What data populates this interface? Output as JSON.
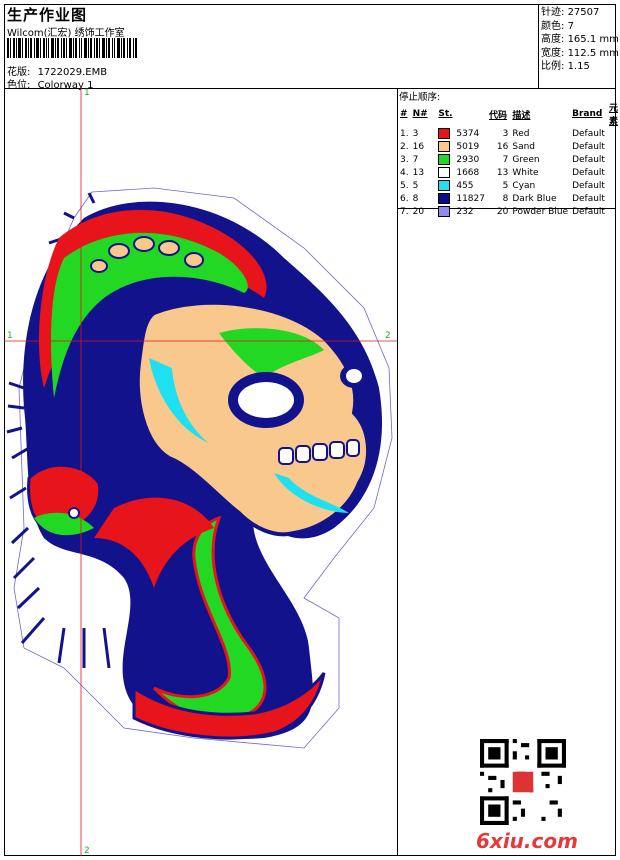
{
  "header": {
    "title": "生产作业图",
    "subtitle": "Wilcom(汇宏) 绣饰工作室",
    "design_label": "花版:",
    "design_file": "1722029.EMB",
    "colorway_label": "色位:",
    "colorway": "Colorway 1"
  },
  "stats": [
    {
      "label": "针迹:",
      "value": "27507"
    },
    {
      "label": "颜色:",
      "value": "7"
    },
    {
      "label": "高度:",
      "value": "165.1 mm"
    },
    {
      "label": "宽度:",
      "value": "112.5 mm"
    },
    {
      "label": "比例:",
      "value": "1.15"
    }
  ],
  "crosshair": {
    "label_v_top": "1",
    "label_v_bottom": "2",
    "label_h_left": "1",
    "label_h_right": "2"
  },
  "stop_sequence": {
    "title": "停止顺序:",
    "headers": [
      "#",
      "N#",
      "St.",
      "代码",
      "描述",
      "Brand",
      "元素"
    ],
    "rows": [
      {
        "idx": "1.",
        "n": "3",
        "color": "#e8141b",
        "st": "5374",
        "code": "3",
        "desc": "Red",
        "brand": "Default"
      },
      {
        "idx": "2.",
        "n": "16",
        "color": "#f8c88c",
        "st": "5019",
        "code": "16",
        "desc": "Sand",
        "brand": "Default"
      },
      {
        "idx": "3.",
        "n": "7",
        "color": "#22d822",
        "st": "2930",
        "code": "7",
        "desc": "Green",
        "brand": "Default"
      },
      {
        "idx": "4.",
        "n": "13",
        "color": "#ffffff",
        "st": "1668",
        "code": "13",
        "desc": "White",
        "brand": "Default"
      },
      {
        "idx": "5.",
        "n": "5",
        "color": "#1ee0f0",
        "st": "455",
        "code": "5",
        "desc": "Cyan",
        "brand": "Default"
      },
      {
        "idx": "6.",
        "n": "8",
        "color": "#0a0a8c",
        "st": "11827",
        "code": "8",
        "desc": "Dark Blue",
        "brand": "Default"
      },
      {
        "idx": "7.",
        "n": "20",
        "color": "#8c8cf0",
        "st": "232",
        "code": "20",
        "desc": "Powder Blue",
        "brand": "Default"
      }
    ]
  },
  "watermark": "6xiu.com"
}
